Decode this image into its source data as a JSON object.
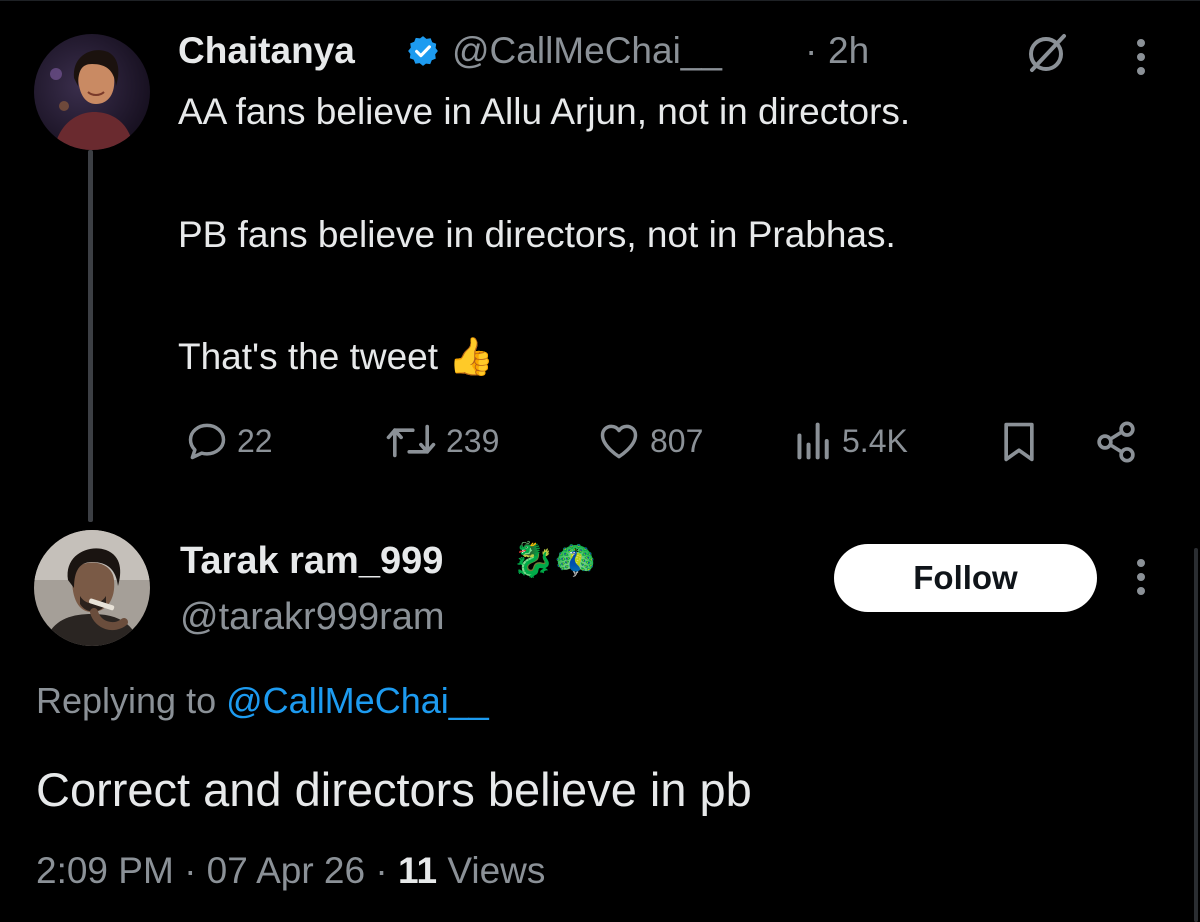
{
  "post": {
    "author_name": "Chaitanya",
    "author_handle": "@CallMeChai__",
    "time_sep": "·",
    "time": "2h",
    "text_line1": "AA fans believe in Allu Arjun, not in directors.",
    "text_line2": "PB fans believe in directors, not in Prabhas.",
    "text_line3": "That's the tweet",
    "text_emoji": "👍",
    "actions": {
      "replies": "22",
      "reposts": "239",
      "likes": "807",
      "views": "5.4K"
    },
    "icons": {
      "verified": "verified-badge-icon",
      "grok": "grok-icon",
      "more": "more-vertical-icon",
      "reply": "reply-icon",
      "repost": "repost-icon",
      "like": "heart-icon",
      "views": "views-icon",
      "bookmark": "bookmark-icon",
      "share": "share-icon"
    }
  },
  "reply": {
    "author_name": "Tarak ram_999",
    "author_emojis": "🐉🦚",
    "author_handle": "@tarakr999ram",
    "follow_label": "Follow",
    "replying_prefix": "Replying to",
    "replying_mention": "@CallMeChai__",
    "text": "Correct and directors believe in pb",
    "timestamp": "2:09 PM · 07 Apr 26 · ",
    "views_count": "11",
    "views_label": " Views"
  },
  "colors": {
    "background": "#000000",
    "text_primary": "#e7e9ea",
    "text_secondary": "#8b9197",
    "accent": "#1d9bf0",
    "verified": "#1d9bf0",
    "thread_line": "#3c3f44"
  }
}
